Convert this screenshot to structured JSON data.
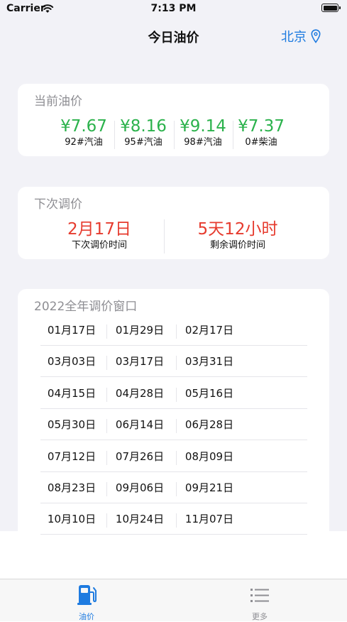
{
  "status_bar": {
    "carrier": "Carrier",
    "time": "7:13 PM"
  },
  "nav": {
    "title": "今日油价",
    "city": "北京"
  },
  "current_price": {
    "title": "当前油价",
    "items": [
      {
        "value": "¥7.67",
        "label": "92#汽油"
      },
      {
        "value": "¥8.16",
        "label": "95#汽油"
      },
      {
        "value": "¥9.14",
        "label": "98#汽油"
      },
      {
        "value": "¥7.37",
        "label": "0#柴油"
      }
    ]
  },
  "next_adjust": {
    "title": "下次调价",
    "date": {
      "value": "2月17日",
      "label": "下次调价时间"
    },
    "remaining": {
      "value": "5天12小时",
      "label": "剩余调价时间"
    }
  },
  "windows": {
    "title": "2022全年调价窗口",
    "rows": [
      [
        "01月17日",
        "01月29日",
        "02月17日"
      ],
      [
        "03月03日",
        "03月17日",
        "03月31日"
      ],
      [
        "04月15日",
        "04月28日",
        "05月16日"
      ],
      [
        "05月30日",
        "06月14日",
        "06月28日"
      ],
      [
        "07月12日",
        "07月26日",
        "08月09日"
      ],
      [
        "08月23日",
        "09月06日",
        "09月21日"
      ],
      [
        "10月10日",
        "10月24日",
        "11月07日"
      ]
    ]
  },
  "tabbar": {
    "items": [
      {
        "label": "油价",
        "icon": "fuel-pump-icon",
        "active": true
      },
      {
        "label": "更多",
        "icon": "list-icon",
        "active": false
      }
    ]
  },
  "colors": {
    "accent": "#1e7be0",
    "price_green": "#2bb24c",
    "alert_red": "#e63b2e",
    "muted": "#8e8e93"
  }
}
